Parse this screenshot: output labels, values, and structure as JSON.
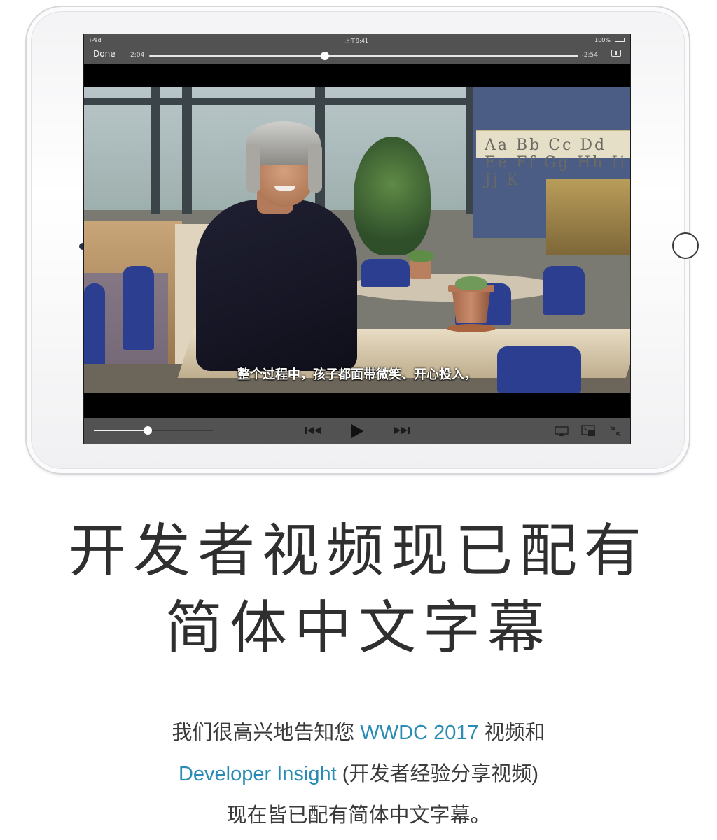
{
  "device": {
    "status_left": "iPad",
    "status_center": "上午9:41",
    "status_right": "100%"
  },
  "player": {
    "done_label": "Done",
    "time_elapsed": "2:04",
    "time_remaining": "-2:54",
    "progress": 0.41,
    "volume": 0.45,
    "subtitle": "整个过程中，孩子都面带微笑、开心投入，",
    "whiteboard_text": "Aa Bb Cc Dd Ee Ff Gg Hh Ii Jj K"
  },
  "headline": {
    "line1": "开发者视频现已配有",
    "line2": "简体中文字幕"
  },
  "body": {
    "line1_text": "我们很高兴地告知您 ",
    "line1_accent": "WWDC 2017",
    "line1_end": " 视频和",
    "line2_accent": "Developer Insight",
    "line2_text": " (开发者经验分享视频)",
    "line3_text": "现在皆已配有简体中文字幕。"
  },
  "colors": {
    "accent": "#2a8bb5",
    "player_bar": "#525252",
    "headline": "#2f2f2f"
  },
  "icons": [
    "skip-back-icon",
    "play-icon",
    "skip-forward-icon",
    "airplay-icon",
    "picture-in-picture-icon",
    "exit-fullscreen-icon",
    "aspect-ratio-icon"
  ]
}
